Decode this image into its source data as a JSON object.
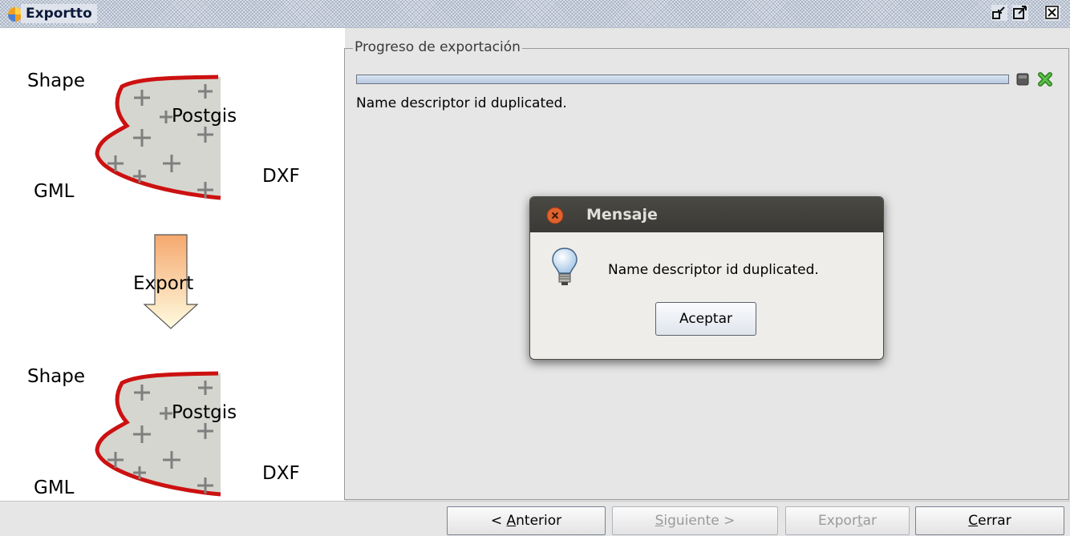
{
  "window": {
    "title": "Exportto",
    "icon": "gvsig-app-icon",
    "controls": [
      "minimize-icon",
      "maximize-icon",
      "close-icon"
    ]
  },
  "illustration": {
    "top": {
      "shape": "Shape",
      "postgis": "Postgis",
      "gml": "GML",
      "dxf": "DXF"
    },
    "arrow_label": "Export",
    "bottom": {
      "shape": "Shape",
      "postgis": "Postgis",
      "gml": "GML",
      "dxf": "DXF"
    }
  },
  "progress": {
    "group_title": "Progreso de exportación",
    "progress_value": 1.0,
    "status": "Name descriptor id duplicated."
  },
  "dialog": {
    "title": "Mensaje",
    "message": "Name descriptor id duplicated.",
    "accept_label": "Aceptar"
  },
  "buttons": {
    "previous": {
      "pre": "< ",
      "key": "A",
      "post": "nterior",
      "enabled": true
    },
    "next": {
      "pre": "",
      "key": "S",
      "post": "iguiente >",
      "enabled": false
    },
    "export": {
      "pre": "Expor",
      "key": "t",
      "post": "ar",
      "enabled": false
    },
    "close": {
      "pre": "",
      "key": "C",
      "post": "errar",
      "enabled": true
    }
  },
  "colors": {
    "titlebar": "#dfe4ec",
    "curve": "#cc1111",
    "shape_fill": "#d4d6cf",
    "arrow_top": "#f5a86e",
    "arrow_bottom": "#fffbe0",
    "cancel_green": "#3fa12c",
    "dialog_header": "#3f3e3a",
    "dialog_close": "#e0622f"
  }
}
